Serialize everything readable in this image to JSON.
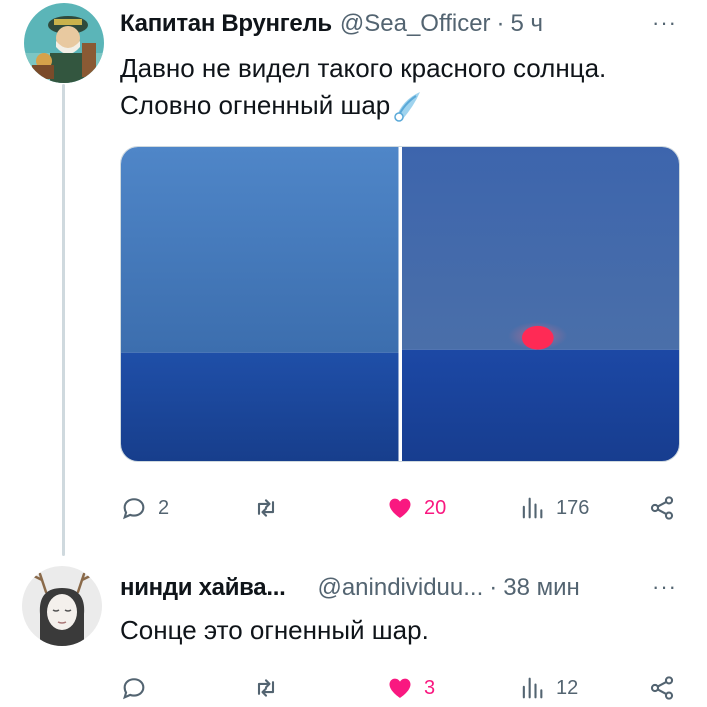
{
  "tweet": {
    "author_name": "Капитан Врунгель",
    "handle": "@Sea_Officer",
    "separator": "·",
    "time": "5 ч",
    "more": "···",
    "text_line1": "Давно не видел такого красного солнца.",
    "text_line2": "Словно огненный шар",
    "emoji": "comet-icon",
    "stats": {
      "replies": "2",
      "retweets": "",
      "likes": "20",
      "views": "176"
    }
  },
  "reply": {
    "author_name": "нинди хайва...",
    "handle": "@anindividuu...",
    "separator": "·",
    "time": "38 мин",
    "more": "···",
    "text": "Сонце это огненный шар.",
    "stats": {
      "replies": "",
      "retweets": "",
      "likes": "3",
      "views": "12"
    }
  },
  "colors": {
    "like_pink": "#f91880",
    "secondary_gray": "#536471",
    "sky": "#3e6fb6",
    "sea": "#1d469b",
    "sun": "#ff2a55"
  }
}
